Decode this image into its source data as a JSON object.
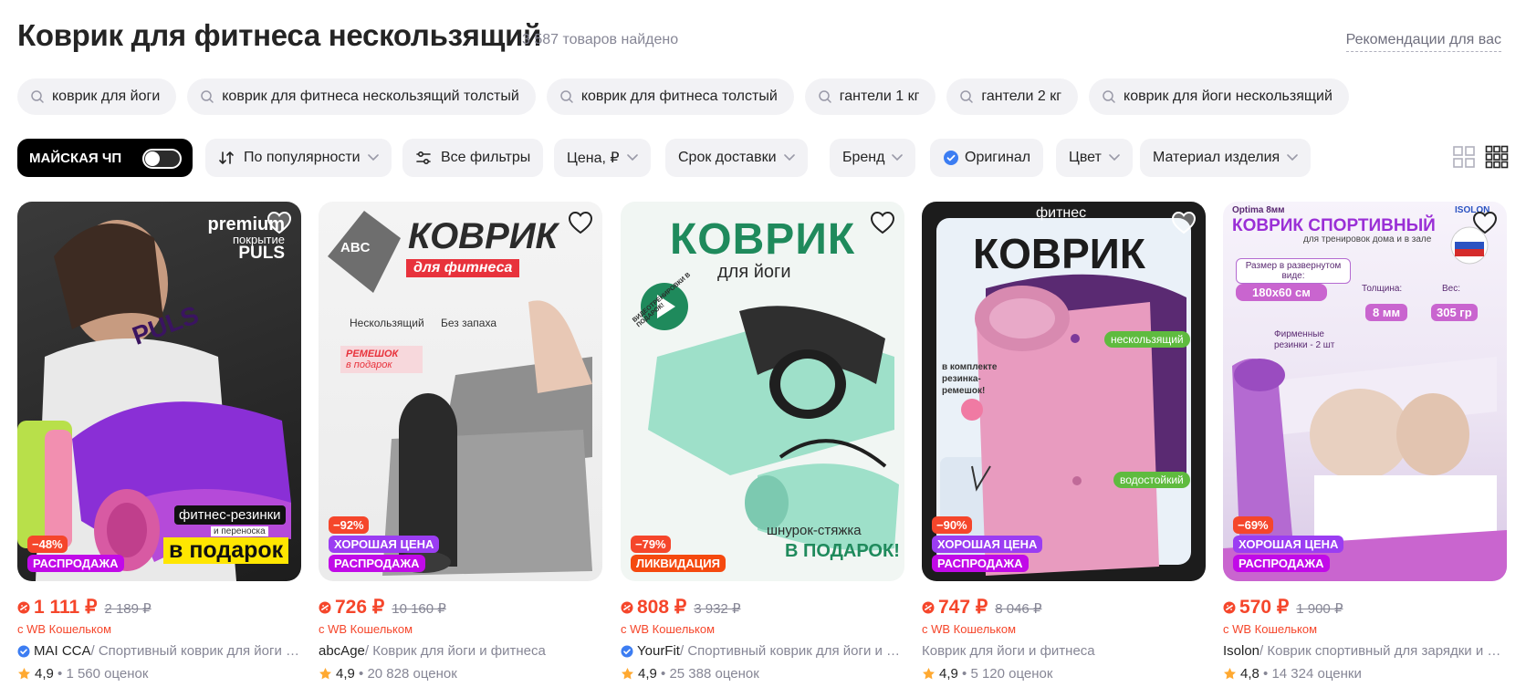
{
  "header": {
    "title": "Коврик для фитнеса нескользящий",
    "count": "3 587 товаров найдено",
    "recommendations_link": "Рекомендации для вас"
  },
  "suggestions": [
    {
      "label": "коврик для йоги",
      "icon": "search-icon"
    },
    {
      "label": "коврик для фитнеса нескользящий толстый",
      "icon": "search-icon"
    },
    {
      "label": "коврик для фитнеса толстый",
      "icon": "search-icon"
    },
    {
      "label": "гантели 1 кг",
      "icon": "search-icon"
    },
    {
      "label": "гантели 2 кг",
      "icon": "search-icon"
    },
    {
      "label": "коврик для йоги нескользящий",
      "icon": "search-icon"
    }
  ],
  "filters": {
    "promo_label": "МАЙСКАЯ ЧП",
    "promo_on": false,
    "sort_label": "По популярности",
    "all_filters_label": "Все фильтры",
    "price_label": "Цена, ₽",
    "delivery_label": "Срок доставки",
    "brand_label": "Бренд",
    "original_label": "Оригинал",
    "color_label": "Цвет",
    "material_label": "Материал изделия"
  },
  "colors": {
    "price_red": "#f5462b",
    "chip_bg": "#f2f2f5",
    "good_price_purple": "#9b3df2",
    "sale_magenta": "#c10ae8",
    "liquidation_orange": "#f5490f",
    "verified_blue": "#3c7df2",
    "star": "#ffa931"
  },
  "products": [
    {
      "discount": "−48%",
      "good_price": "",
      "sale": "РАСПРОДАЖА",
      "image_texts": {
        "t1": "premium",
        "t2": "покрытие",
        "t3": "PULS",
        "t4": "фитнес-резинки",
        "t5": "и переноска",
        "t6": "в подарок",
        "t7": "PULS"
      },
      "price": "1 111 ₽",
      "old_price": "2 189 ₽",
      "wallet": "с WB Кошельком",
      "brand": "MAI CCA",
      "name": " / Спортивный коврик для йоги и фитнеса",
      "verified": true,
      "rating": "4,9",
      "reviews": "• 1 560 оценок"
    },
    {
      "discount": "−92%",
      "good_price": "ХОРОШАЯ ЦЕНА",
      "sale": "РАСПРОДАЖА",
      "image_texts": {
        "t1": "КОВРИК",
        "t2": "для фитнеса",
        "t3": "Нескользящий",
        "t4": "Без запаха",
        "t5": "РЕМЕШОК",
        "t6": "в подарок",
        "t7": "ABC"
      },
      "price": "726 ₽",
      "old_price": "10 160 ₽",
      "wallet": "с WB Кошельком",
      "brand": "abcAge",
      "name": " / Коврик для йоги и фитнеса",
      "verified": false,
      "rating": "4,9",
      "reviews": "• 20 828 оценок"
    },
    {
      "discount": "−79%",
      "good_price": "",
      "sale": "ЛИКВИДАЦИЯ",
      "image_texts": {
        "t1": "КОВРИК",
        "t2": "для йоги",
        "t3": "ВИДЕОТРЕНИРОВКИ В ПОДАРОК!",
        "t4": "шнурок-стяжка",
        "t5": "В ПОДАРОК!"
      },
      "price": "808 ₽",
      "old_price": "3 932 ₽",
      "wallet": "с WB Кошельком",
      "brand": "YourFit",
      "name": " / Спортивный коврик для йоги и фитнеса",
      "verified": true,
      "rating": "4,9",
      "reviews": "• 25 388 оценок"
    },
    {
      "discount": "−90%",
      "good_price": "ХОРОШАЯ ЦЕНА",
      "sale": "РАСПРОДАЖА",
      "image_texts": {
        "t1": "фитнес",
        "t2": "КОВРИК",
        "t3": "нескользящий",
        "t4": "водостойкий",
        "t5": "в комплекте резинка-ремешок!"
      },
      "price": "747 ₽",
      "old_price": "8 046 ₽",
      "wallet": "с WB Кошельком",
      "brand": "",
      "name": "Коврик для йоги и фитнеса",
      "verified": false,
      "rating": "4,9",
      "reviews": "• 5 120 оценок"
    },
    {
      "discount": "−69%",
      "good_price": "ХОРОШАЯ ЦЕНА",
      "sale": "РАСПРОДАЖА",
      "image_texts": {
        "t1": "Optima 8мм",
        "t2": "КОВРИК СПОРТИВНЫЙ",
        "t3": "для тренировок дома и в зале",
        "t4": "Размер в развернутом виде:",
        "t5": "180x60 см",
        "t6": "Толщина:",
        "t7": "8 мм",
        "t8": "Вес:",
        "t9": "305 гр",
        "t10": "Фирменные резинки - 2 шт",
        "t11": "ISOLON"
      },
      "price": "570 ₽",
      "old_price": "1 900 ₽",
      "wallet": "с WB Кошельком",
      "brand": "Isolon",
      "name": " / Коврик спортивный для зарядки и фитнеса",
      "verified": false,
      "rating": "4,8",
      "reviews": "• 14 324 оценки"
    }
  ]
}
